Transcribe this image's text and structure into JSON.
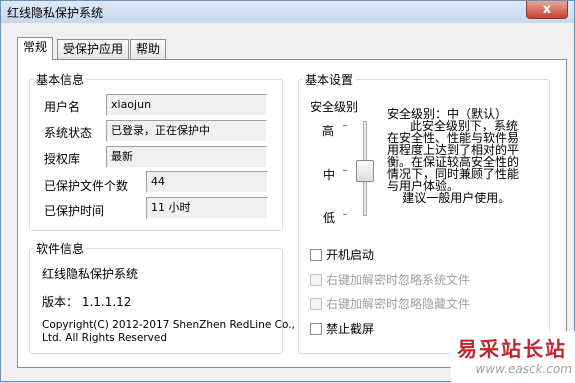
{
  "window": {
    "title": "红线隐私保护系统",
    "close_glyph": "x"
  },
  "tabs": [
    {
      "label": "常规"
    },
    {
      "label": "受保护应用"
    },
    {
      "label": "帮助"
    }
  ],
  "basic_info": {
    "title": "基本信息",
    "username_label": "用户名",
    "username": "xiaojun",
    "status_label": "系统状态",
    "status": "已登录，正在保护中",
    "auth_label": "授权库",
    "auth": "最新",
    "files_label": "已保护文件个数",
    "files": "44",
    "time_label": "已保护时间",
    "time": "11 小时"
  },
  "software_info": {
    "title": "软件信息",
    "name": "红线隐私保护系统",
    "version": "版本： 1.1.1.12",
    "copyright_line1": "Copyright(C) 2012-2017 ShenZhen RedLine Co.,",
    "copyright_line2": "Ltd. All Rights Reserved"
  },
  "basic_settings": {
    "title": "基本设置",
    "security_label": "安全级别",
    "slider": {
      "high": "高",
      "mid": "中",
      "low": "低",
      "current": "中"
    },
    "description": [
      "安全级别：中（默认）",
      "      此安全级别下，系统",
      "在安全性、性能与软件易",
      "用程度上达到了相对的平",
      "衡。在保证较高安全性的",
      "情况下，同时兼顾了性能",
      "与用户体验。",
      "    建议一般用户使用。"
    ],
    "options": [
      {
        "label": "开机启动",
        "checked": false,
        "enabled": true
      },
      {
        "label": "右键加解密时忽略系统文件",
        "checked": false,
        "enabled": false
      },
      {
        "label": "右键加解密时忽略隐藏文件",
        "checked": false,
        "enabled": false
      },
      {
        "label": "禁止截屏",
        "checked": false,
        "enabled": true
      }
    ]
  },
  "watermark": {
    "main": "易采站长站",
    "sub": "www.easck.com"
  }
}
